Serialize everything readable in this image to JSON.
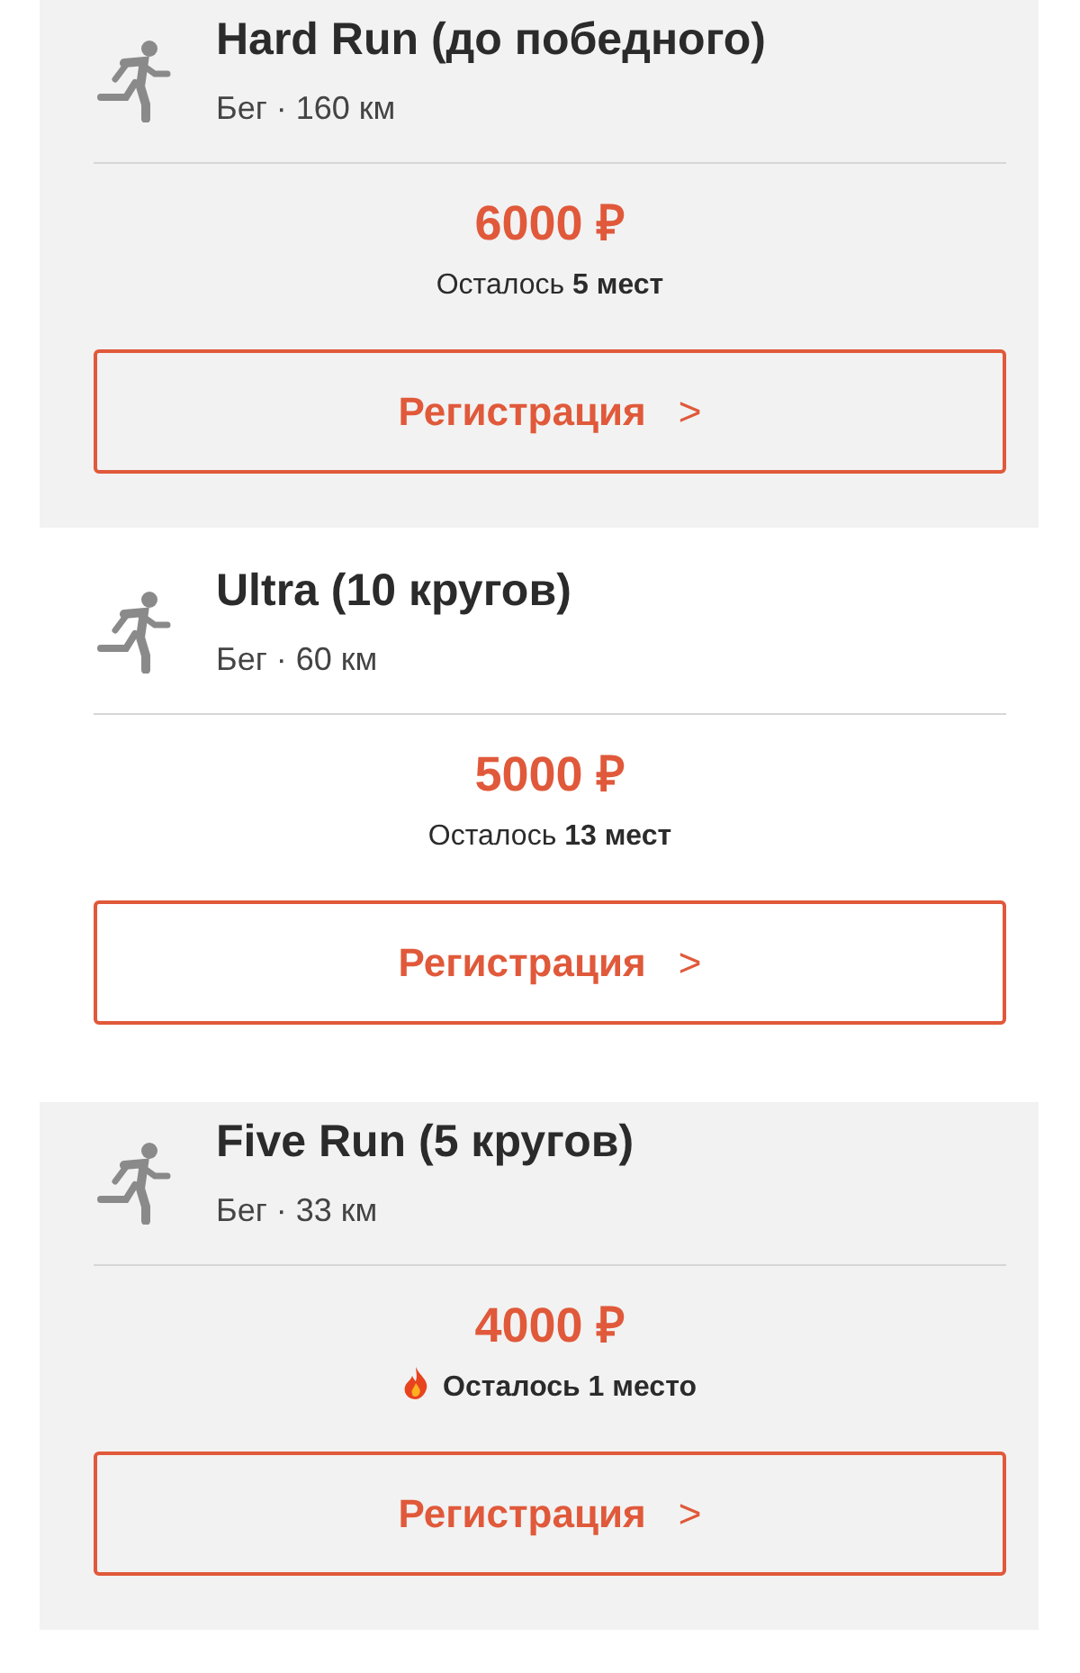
{
  "events": [
    {
      "title": "Hard Run (до победного)",
      "meta": "Бег · 160 км",
      "price": "6000 ₽",
      "seats": "Осталось **5 мест**",
      "urgent": false,
      "shaded": true,
      "button": "Регистрация",
      "button_arrow": ">"
    },
    {
      "title": "Ultra (10 кругов)",
      "meta": "Бег · 60 км",
      "price": "5000 ₽",
      "seats": "Осталось **13 мест**",
      "urgent": false,
      "shaded": false,
      "button": "Регистрация",
      "button_arrow": ">"
    },
    {
      "title": "Five Run (5 кругов)",
      "meta": "Бег · 33 км",
      "price": "4000 ₽",
      "seats": "Осталось 1 место",
      "urgent": true,
      "shaded": true,
      "button": "Регистрация",
      "button_arrow": ">"
    }
  ]
}
